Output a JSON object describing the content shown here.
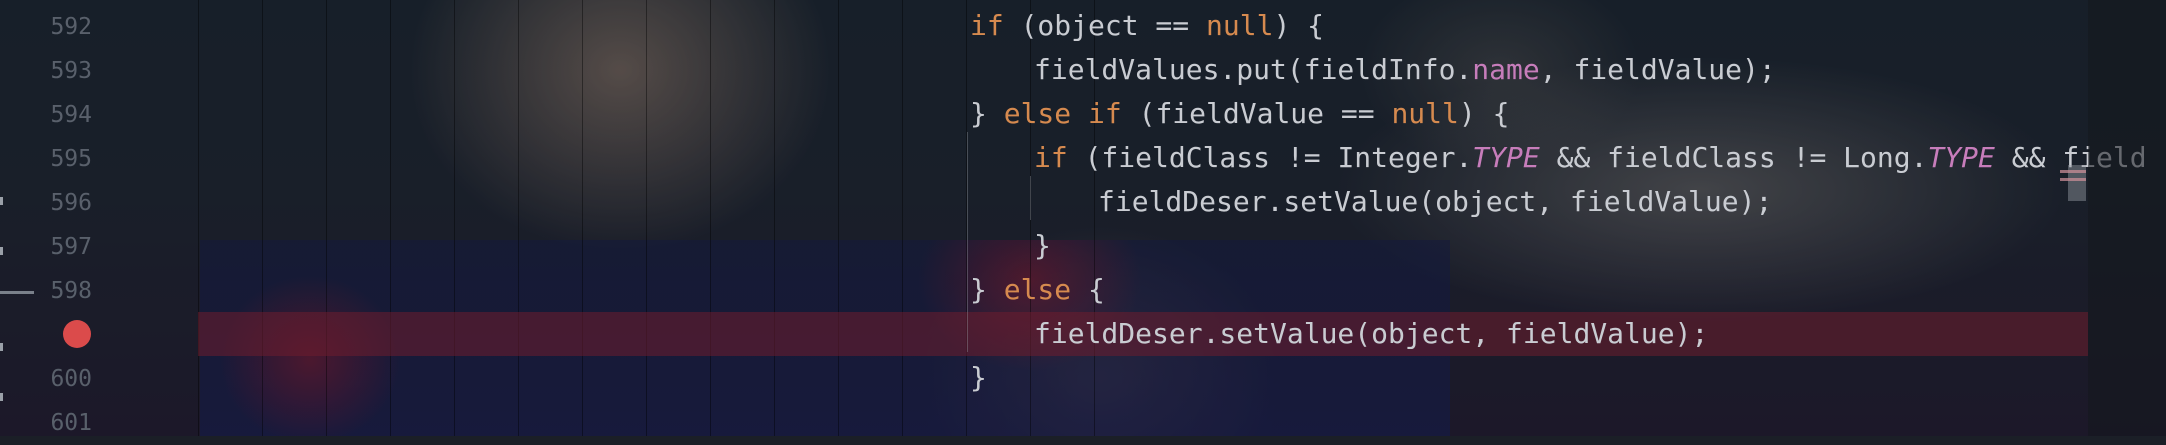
{
  "editor": {
    "line_numbers": [
      "592",
      "593",
      "594",
      "595",
      "596",
      "597",
      "598",
      "",
      "600",
      "601"
    ],
    "breakpoint_line": "599",
    "code": [
      "if (object == null) {",
      "fieldValues.put(fieldInfo.name, fieldValue);",
      "} else if (fieldValue == null) {",
      "if (fieldClass != Integer.TYPE && fieldClass != Long.TYPE && field",
      "fieldDeser.setValue(object, fieldValue);",
      "}",
      "} else {",
      "fieldDeser.setValue(object, fieldValue);",
      "}",
      ""
    ],
    "colors": {
      "keyword": "#d68a4f",
      "field": "#c77dbb",
      "text": "#c9ccd2",
      "line_number": "#59606b",
      "breakpoint": "#db4b4b",
      "highlight_row": "#6e1e2d"
    }
  }
}
